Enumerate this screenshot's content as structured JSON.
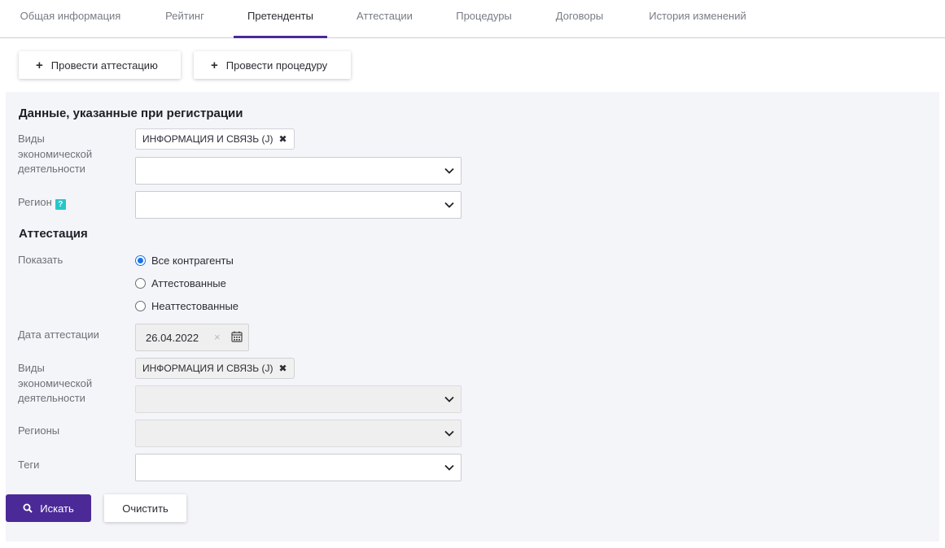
{
  "tabs": [
    {
      "label": "Общая информация"
    },
    {
      "label": "Рейтинг"
    },
    {
      "label": "Претенденты",
      "active": true
    },
    {
      "label": "Аттестации"
    },
    {
      "label": "Процедуры"
    },
    {
      "label": "Договоры"
    },
    {
      "label": "История изменений"
    }
  ],
  "actions": {
    "attest_label": "Провести аттестацию",
    "procedure_label": "Провести процедуру",
    "plus": "+"
  },
  "registration": {
    "title": "Данные, указанные при регистрации",
    "activity_label_lines": [
      "Виды",
      "экономической",
      "деятельности"
    ],
    "activity_chip": "ИНФОРМАЦИЯ И СВЯЗЬ (J)",
    "region_label": "Регион",
    "help_icon": "?"
  },
  "attestation": {
    "title": "Аттестация",
    "show_label": "Показать",
    "options": [
      "Все контрагенты",
      "Аттестованные",
      "Неаттестованные"
    ],
    "selected_option": "Все контрагенты",
    "date_label": "Дата аттестации",
    "date_value": "26.04.2022",
    "date_clear": "×",
    "activity_label_lines": [
      "Виды",
      "экономической",
      "деятельности"
    ],
    "activity_chip": "ИНФОРМАЦИЯ И СВЯЗЬ (J)",
    "regions_label": "Регионы",
    "tags_label": "Теги"
  },
  "buttons": {
    "search_label": "Искать",
    "clear_label": "Очистить"
  },
  "colors": {
    "accent": "#4b2a97",
    "radio_selected": "#1a73e8",
    "help_badge": "#26c6c9",
    "panel_bg": "#f4f5f9"
  },
  "icons": {
    "chip_remove": "close-icon",
    "select_arrow": "chevron-down-icon",
    "date_picker": "calendar-icon",
    "search": "search-icon",
    "action": "plus-icon"
  }
}
